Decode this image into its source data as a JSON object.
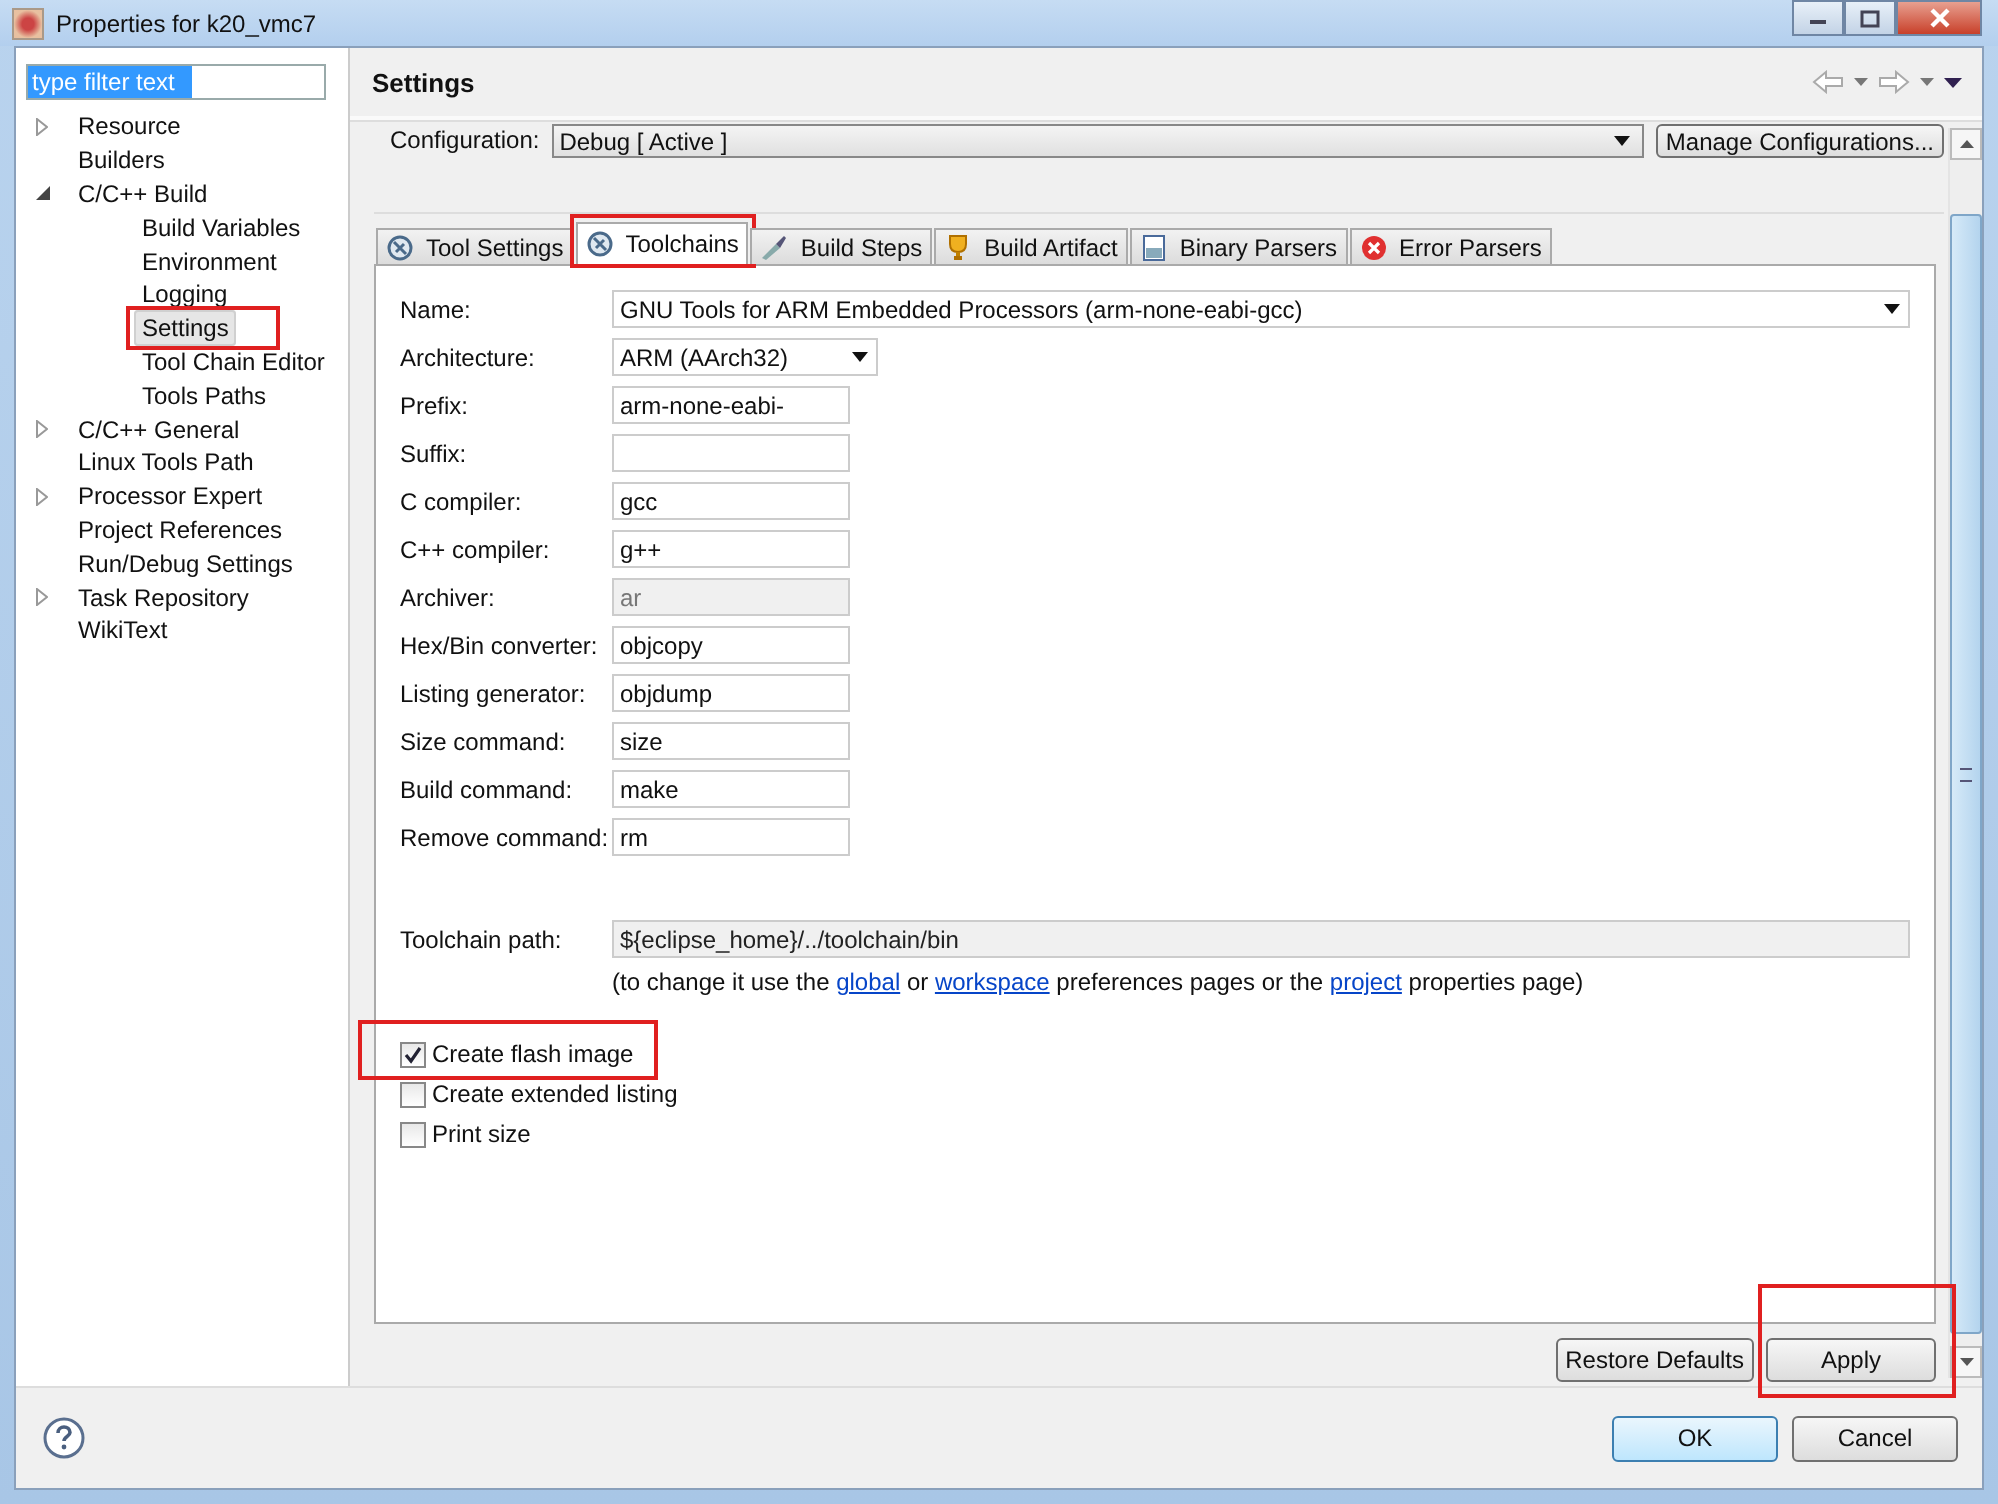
{
  "window": {
    "title": "Properties for k20_vmc7"
  },
  "filter": {
    "value": "type filter text"
  },
  "tree": [
    {
      "label": "Resource",
      "expanded": false,
      "selected": false
    },
    {
      "label": "Builders",
      "selected": false
    },
    {
      "label": "C/C++ Build",
      "expanded": true,
      "selected": false,
      "children": [
        {
          "label": "Build Variables",
          "selected": false
        },
        {
          "label": "Environment",
          "selected": false
        },
        {
          "label": "Logging",
          "selected": false
        },
        {
          "label": "Settings",
          "selected": true,
          "annotated": true
        },
        {
          "label": "Tool Chain Editor",
          "selected": false
        },
        {
          "label": "Tools Paths",
          "selected": false
        }
      ]
    },
    {
      "label": "C/C++ General",
      "expanded": false,
      "selected": false
    },
    {
      "label": "Linux Tools Path",
      "selected": false
    },
    {
      "label": "Processor Expert",
      "expanded": false,
      "selected": false
    },
    {
      "label": "Project References",
      "selected": false
    },
    {
      "label": "Run/Debug Settings",
      "selected": false
    },
    {
      "label": "Task Repository",
      "expanded": false,
      "selected": false
    },
    {
      "label": "WikiText",
      "selected": false
    }
  ],
  "page_title": "Settings",
  "configuration": {
    "label": "Configuration:",
    "value": "Debug  [ Active ]",
    "button": "Manage Configurations..."
  },
  "tabs": [
    {
      "label": "Tool Settings",
      "selected": false
    },
    {
      "label": "Toolchains",
      "selected": true,
      "annotated": true
    },
    {
      "label": "Build Steps",
      "selected": false
    },
    {
      "label": "Build Artifact",
      "selected": false
    },
    {
      "label": "Binary Parsers",
      "selected": false
    },
    {
      "label": "Error Parsers",
      "selected": false
    }
  ],
  "fields": [
    {
      "label": "Name:",
      "value": "GNU Tools for ARM Embedded Processors (arm-none-eabi-gcc)",
      "kind": "wide-combo"
    },
    {
      "label": "Architecture:",
      "value": "ARM (AArch32)",
      "kind": "combo"
    },
    {
      "label": "Prefix:",
      "value": "arm-none-eabi-",
      "kind": "text",
      "disabled": false
    },
    {
      "label": "Suffix:",
      "kind": "text",
      "disabled": false
    },
    {
      "label": "C compiler:",
      "value": "gcc",
      "kind": "text",
      "disabled": false
    },
    {
      "label": "C++ compiler:",
      "value": "g++",
      "kind": "text",
      "disabled": false
    },
    {
      "label": "Archiver:",
      "value": "ar",
      "kind": "text",
      "disabled": true
    },
    {
      "label": "Hex/Bin converter:",
      "value": "objcopy",
      "kind": "text",
      "disabled": false
    },
    {
      "label": "Listing generator:",
      "value": "objdump",
      "kind": "text",
      "disabled": false
    },
    {
      "label": "Size command:",
      "value": "size",
      "kind": "text",
      "disabled": false
    },
    {
      "label": "Build command:",
      "value": "make",
      "kind": "text",
      "disabled": false
    },
    {
      "label": "Remove command:",
      "value": "rm",
      "kind": "text",
      "disabled": false
    }
  ],
  "toolchain_path": {
    "label": "Toolchain path:",
    "value": "${eclipse_home}/../toolchain/bin",
    "note": [
      {
        "text": "(to change it use the "
      },
      {
        "text": "global",
        "link": true
      },
      {
        "text": " or "
      },
      {
        "text": "workspace",
        "link": true
      },
      {
        "text": " preferences pages or the "
      },
      {
        "text": "project",
        "link": true
      },
      {
        "text": " properties page)"
      }
    ]
  },
  "checkboxes": [
    {
      "label": "Create flash image",
      "checked": true,
      "annotated": true
    },
    {
      "label": "Create extended listing",
      "checked": false
    },
    {
      "label": "Print size",
      "checked": false
    }
  ],
  "page_buttons": [
    {
      "label": "Restore Defaults"
    },
    {
      "label": "Apply",
      "annotated": true
    }
  ],
  "dialog_buttons": [
    {
      "label": "OK",
      "default": true
    },
    {
      "label": "Cancel",
      "default": false
    }
  ]
}
